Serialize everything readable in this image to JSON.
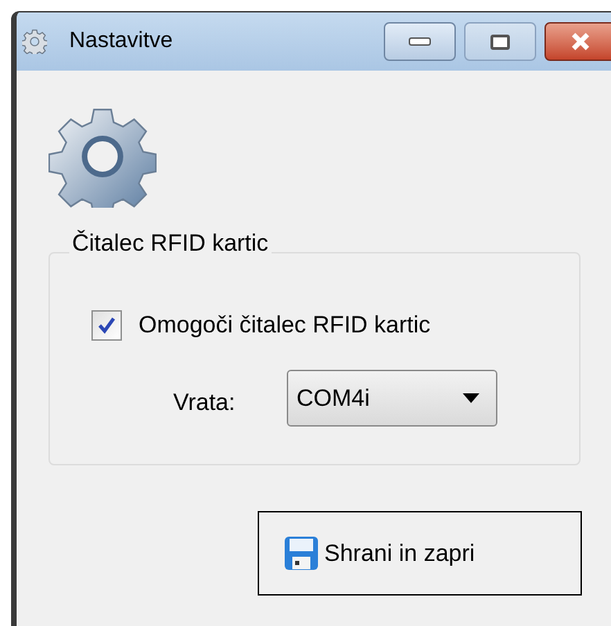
{
  "window": {
    "title": "Nastavitve"
  },
  "group": {
    "title": "Čitalec RFID kartic",
    "enable": {
      "label": "Omogoči čitalec RFID kartic",
      "checked": true
    },
    "port": {
      "label": "Vrata:",
      "value": "COM4i"
    }
  },
  "buttons": [
    {
      "label": "Shrani in zapri"
    }
  ]
}
